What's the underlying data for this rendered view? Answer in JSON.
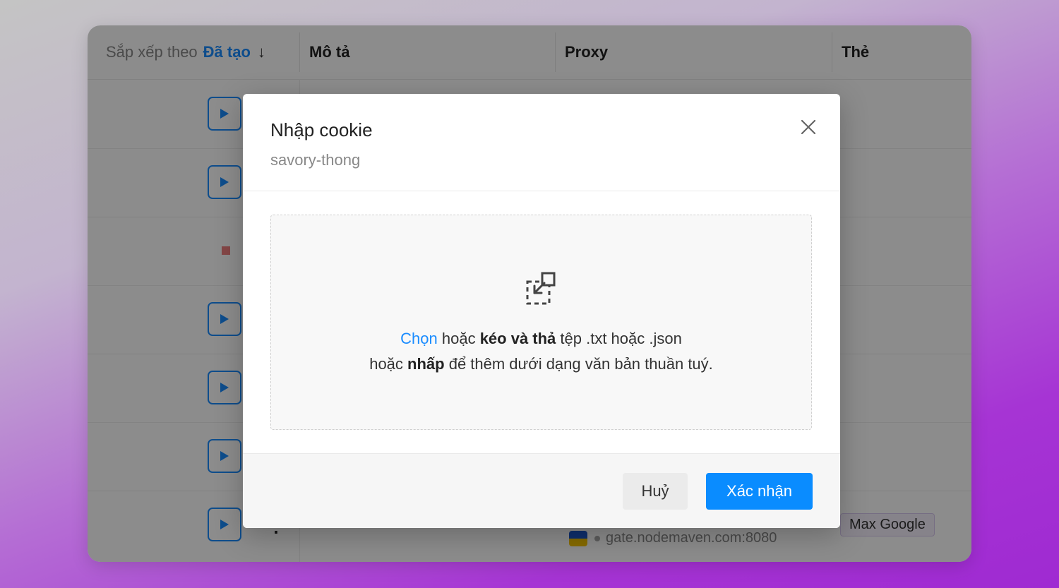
{
  "table": {
    "sort_prefix": "Sắp xếp theo",
    "sort_field": "Đã tạo",
    "sort_arrow": "↓",
    "col_description": "Mô tả",
    "col_proxy": "Proxy",
    "col_tags": "Thẻ"
  },
  "last_row": {
    "more": "⋮",
    "proxy_host": "gate.nodemaven.com:8080",
    "tag": "Max Google"
  },
  "modal": {
    "title": "Nhập cookie",
    "subtitle": "savory-thong",
    "drop_choose": "Chọn",
    "drop_or1": " hoặc ",
    "drop_drag": "kéo và thả",
    "drop_files": " tệp .txt hoặc .json",
    "drop_or2": "hoặc ",
    "drop_click": "nhấp",
    "drop_plain": " để thêm dưới dạng văn bản thuần tuý.",
    "cancel_label": "Huỷ",
    "confirm_label": "Xác nhận"
  },
  "colors": {
    "accent": "#0a8cff",
    "stop": "#f08080"
  }
}
